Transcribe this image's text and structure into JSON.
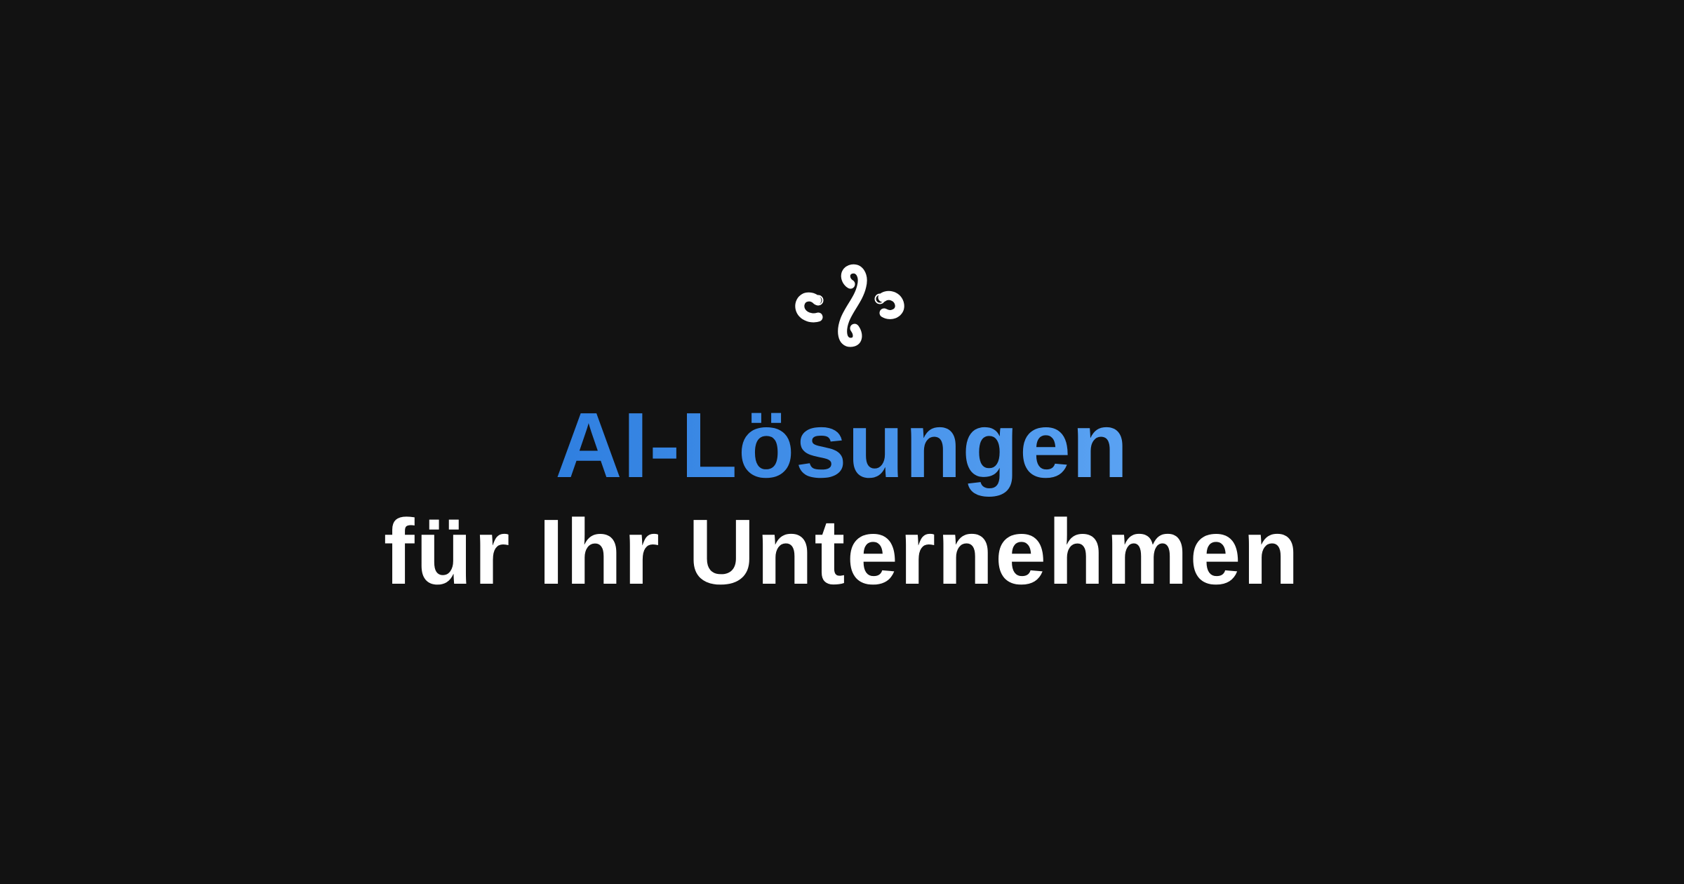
{
  "colors": {
    "background": "#121212",
    "accent_start": "#2f7fe0",
    "accent_end": "#5aa2f2",
    "text_primary": "#ffffff"
  },
  "logo": {
    "icon": "swirl-logo-icon"
  },
  "headline": {
    "line1": "AI-Lösungen",
    "line2": "für Ihr Unternehmen"
  }
}
